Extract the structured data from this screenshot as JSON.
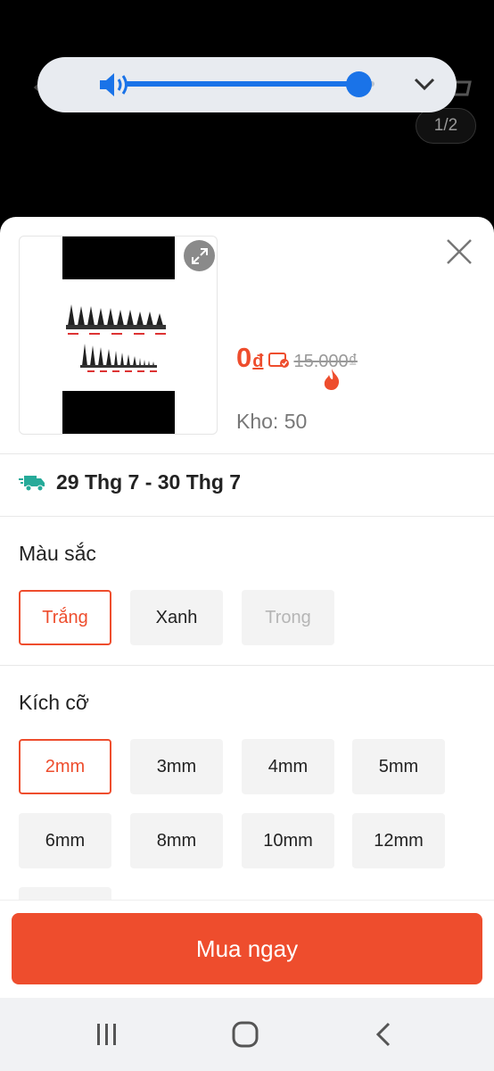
{
  "image_counter": "1/2",
  "volume": {
    "level": 0.95
  },
  "product": {
    "price": "0",
    "price_currency": "đ",
    "original_price": "15.000₫",
    "stock_label": "Kho: 50"
  },
  "shipping": {
    "date_range": "29 Thg 7 - 30 Thg 7"
  },
  "color_section": {
    "title": "Màu sắc",
    "options": [
      "Trắng",
      "Xanh",
      "Trong"
    ]
  },
  "size_section": {
    "title": "Kích cỡ",
    "options": [
      "2mm",
      "3mm",
      "4mm",
      "5mm",
      "6mm",
      "8mm",
      "10mm",
      "12mm"
    ]
  },
  "buy_button": "Mua ngay",
  "colors": {
    "accent": "#ee4d2d",
    "volume": "#1a73e8"
  }
}
